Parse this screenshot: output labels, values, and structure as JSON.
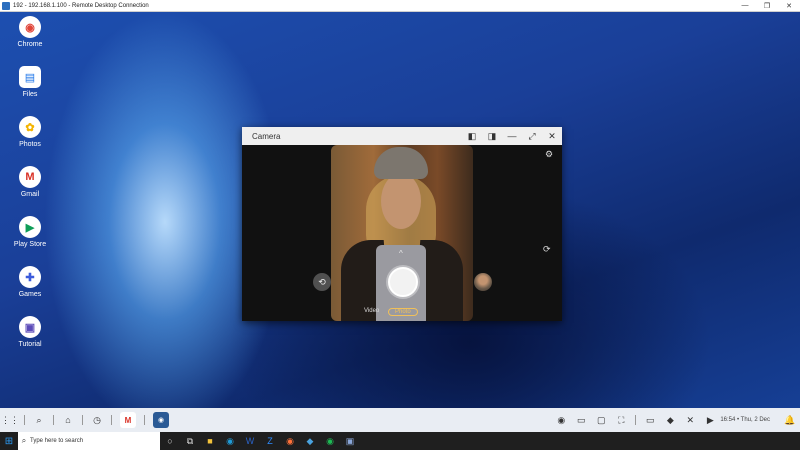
{
  "rdp": {
    "title": "192 - 192.168.1.100 - Remote Desktop Connection",
    "controls": [
      "—",
      "❐",
      "✕"
    ]
  },
  "desktop_icons": [
    {
      "label": "Chrome",
      "glyph": "◉",
      "color": "#e0463a"
    },
    {
      "label": "Files",
      "glyph": "▤",
      "color": "#1a73e8"
    },
    {
      "label": "Photos",
      "glyph": "✿",
      "color": "#f4b400"
    },
    {
      "label": "Gmail",
      "glyph": "M",
      "color": "#d93025"
    },
    {
      "label": "Play Store",
      "glyph": "▶",
      "color": "#0f9d58"
    },
    {
      "label": "Games",
      "glyph": "✚",
      "color": "#3b5bdb"
    },
    {
      "label": "Tutorial",
      "glyph": "▣",
      "color": "#5b4bb8"
    }
  ],
  "camera_window": {
    "title": "Camera",
    "controls": {
      "dock_left": "◧",
      "dock_right": "◨",
      "minimize": "—",
      "maximize": "⤢",
      "close": "✕"
    },
    "modes": {
      "video": "Video",
      "photo": "Photo"
    },
    "icons": {
      "settings": "⚙",
      "rotate": "⟳",
      "switch_camera": "⟲",
      "chevron": "^"
    }
  },
  "shelf": {
    "launcher": "⋮⋮",
    "left_icons": [
      "⌕",
      "⌂",
      "◷"
    ],
    "apps": {
      "gmail": "M",
      "camera": "◉"
    },
    "tray_icons": [
      "◉",
      "▭",
      "▢",
      "⛶",
      "▭",
      "◆",
      "✕",
      "▶"
    ],
    "clock": "16:54 • Thu, 2 Dec",
    "notification": "🔔"
  },
  "taskbar": {
    "start": "⊞",
    "search_placeholder": "Type here to search",
    "apps": [
      {
        "name": "task-view",
        "glyph": "○",
        "color": "#dddddd"
      },
      {
        "name": "widgets",
        "glyph": "⧉",
        "color": "#dddddd"
      },
      {
        "name": "file-explorer",
        "glyph": "■",
        "color": "#f3c33b"
      },
      {
        "name": "edge",
        "glyph": "◉",
        "color": "#1f9ad6"
      },
      {
        "name": "word",
        "glyph": "W",
        "color": "#2b63c9"
      },
      {
        "name": "zoom",
        "glyph": "Z",
        "color": "#2d8cff"
      },
      {
        "name": "firefox",
        "glyph": "◉",
        "color": "#ff7139"
      },
      {
        "name": "store",
        "glyph": "◆",
        "color": "#4aa3df"
      },
      {
        "name": "spotify",
        "glyph": "◉",
        "color": "#1db954"
      },
      {
        "name": "rdp",
        "glyph": "▣",
        "color": "#8aa6d8"
      }
    ]
  }
}
